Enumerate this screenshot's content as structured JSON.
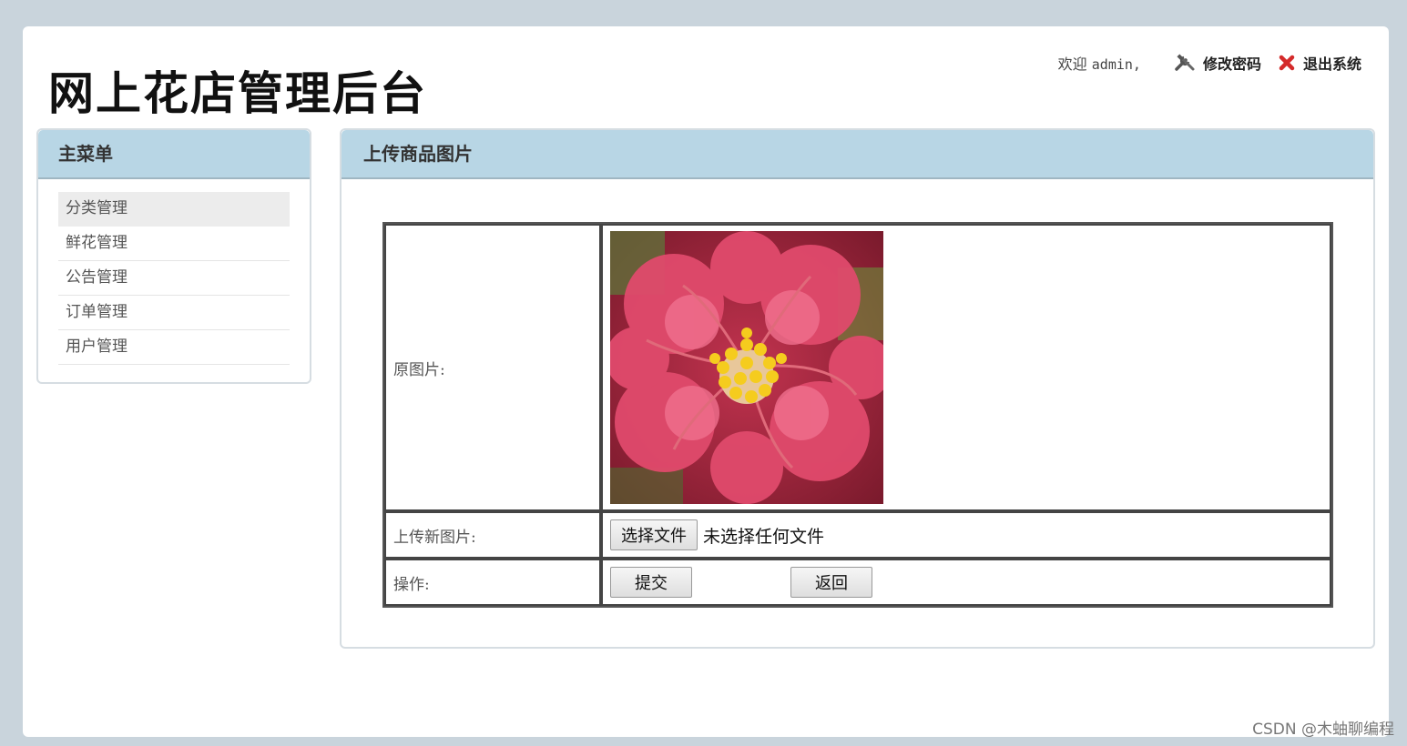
{
  "header": {
    "site_title": "网上花店管理后台",
    "welcome_prefix": "欢迎",
    "username": "admin,",
    "change_password": "修改密码",
    "logout": "退出系统"
  },
  "sidebar": {
    "title": "主菜单",
    "items": [
      {
        "label": "分类管理",
        "active": true
      },
      {
        "label": "鲜花管理",
        "active": false
      },
      {
        "label": "公告管理",
        "active": false
      },
      {
        "label": "订单管理",
        "active": false
      },
      {
        "label": "用户管理",
        "active": false
      }
    ]
  },
  "main": {
    "title": "上传商品图片",
    "form": {
      "original_label": "原图片:",
      "upload_label": "上传新图片:",
      "choose_file_button": "选择文件",
      "file_status": "未选择任何文件",
      "ops_label": "操作:",
      "submit_button": "提交",
      "back_button": "返回"
    }
  },
  "watermark": "CSDN @木蚰聊编程",
  "colors": {
    "page_bg": "#c9d4dc",
    "panel_header": "#b8d6e5",
    "active_menu": "#ececec"
  }
}
